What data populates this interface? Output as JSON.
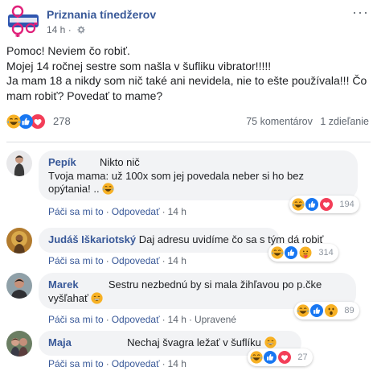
{
  "post": {
    "page_name": "Priznania tínedžerov",
    "time": "14 h",
    "privacy_icon": "gear-icon",
    "more_icon": "more-dots-icon",
    "logo_icon": "page-logo-icon",
    "text_lines": [
      "Pomoc! Neviem čo robiť.",
      "Mojej 14 ročnej sestre som našla v šufliku vibrator!!!!!",
      "Ja mam 18 a nikdy som nič také ani nevidela, nie to ešte používala!!! Čo",
      "mam robiť? Povedať to mame?"
    ],
    "reactions": {
      "icons": [
        "haha-icon",
        "like-icon",
        "love-icon"
      ],
      "count": "278"
    },
    "comments_count": "75 komentárov",
    "shares_count": "1 zdieľanie"
  },
  "comments": [
    {
      "author": "Pepík",
      "line1": "Nikto nič",
      "line2": "Tvoja mama: už 100x som jej povedala neber si ho bez",
      "line3": "opýtania! ..",
      "like": "Páči sa mi to",
      "reply": "Odpovedať",
      "time": "14 h",
      "edited": "",
      "reaction_icons": [
        "haha-icon",
        "like-icon",
        "love-icon"
      ],
      "reaction_count": "194"
    },
    {
      "author": "Judáš Iškariotský",
      "text": "Daj adresu uvidíme čo sa s tým dá robiť",
      "like": "Páči sa mi to",
      "reply": "Odpovedať",
      "time": "14 h",
      "edited": "",
      "reaction_icons": [
        "haha-icon",
        "like-icon",
        "care-icon"
      ],
      "reaction_count": "314"
    },
    {
      "author": "Marek",
      "text": "Sestru nezbedn",
      "line1": "Sestru nezbednú by si mala žihľavou po p.čke",
      "line2": "vyšľahať",
      "like": "Páči sa mi to",
      "reply": "Odpovedať",
      "time": "14 h",
      "edited": "Upravené",
      "reaction_icons": [
        "haha-icon",
        "like-icon",
        "wow-icon"
      ],
      "reaction_count": "89"
    },
    {
      "author": "Maja",
      "text": "Nechaj švagra ležať v šuflíku",
      "like": "Páči sa mi to",
      "reply": "Odpovedať",
      "time": "14 h",
      "edited": "",
      "reaction_icons": [
        "haha-icon",
        "like-icon",
        "love-icon"
      ],
      "reaction_count": "27"
    }
  ],
  "colors": {
    "link": "#385898",
    "like_blue": "#1877f2",
    "love_red": "#f33e58",
    "haha_yellow": "#f7b125",
    "bubble_bg": "#f2f3f5",
    "muted": "#606770"
  }
}
